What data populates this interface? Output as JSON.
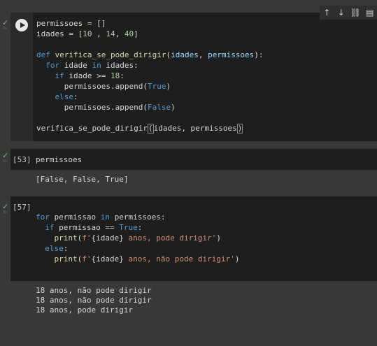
{
  "toolbar": {
    "move_up_icon": "arrow-up-icon",
    "move_down_icon": "arrow-down-icon",
    "link_icon": "link-icon",
    "comment_icon": "comment-icon"
  },
  "cells": [
    {
      "status": "✓",
      "time": "0s",
      "code": [
        "permissoes = []",
        "idades = [10 , 14, 40]",
        "",
        "def verifica_se_pode_dirigir(idades, permissoes):",
        "  for idade in idades:",
        "    if idade >= 18:",
        "      permissoes.append(True)",
        "    else:",
        "      permissoes.append(False)",
        "",
        "verifica_se_pode_dirigir(idades, permissoes)"
      ]
    },
    {
      "status": "✓",
      "time": "0s",
      "exec_count": "[53]",
      "code": [
        "permissoes"
      ],
      "output": [
        "[False, False, True]"
      ]
    },
    {
      "status": "✓",
      "time": "0s",
      "exec_count": "[57]",
      "code": [
        "for permissao in permissoes:",
        "  if permissao == True:",
        "    print(f'{idade} anos, pode dirigir')",
        "  else:",
        "    print(f'{idade} anos, não pode dirigir')"
      ],
      "output": [
        "18 anos, não pode dirigir",
        "18 anos, não pode dirigir",
        "18 anos, pode dirigir"
      ]
    }
  ]
}
